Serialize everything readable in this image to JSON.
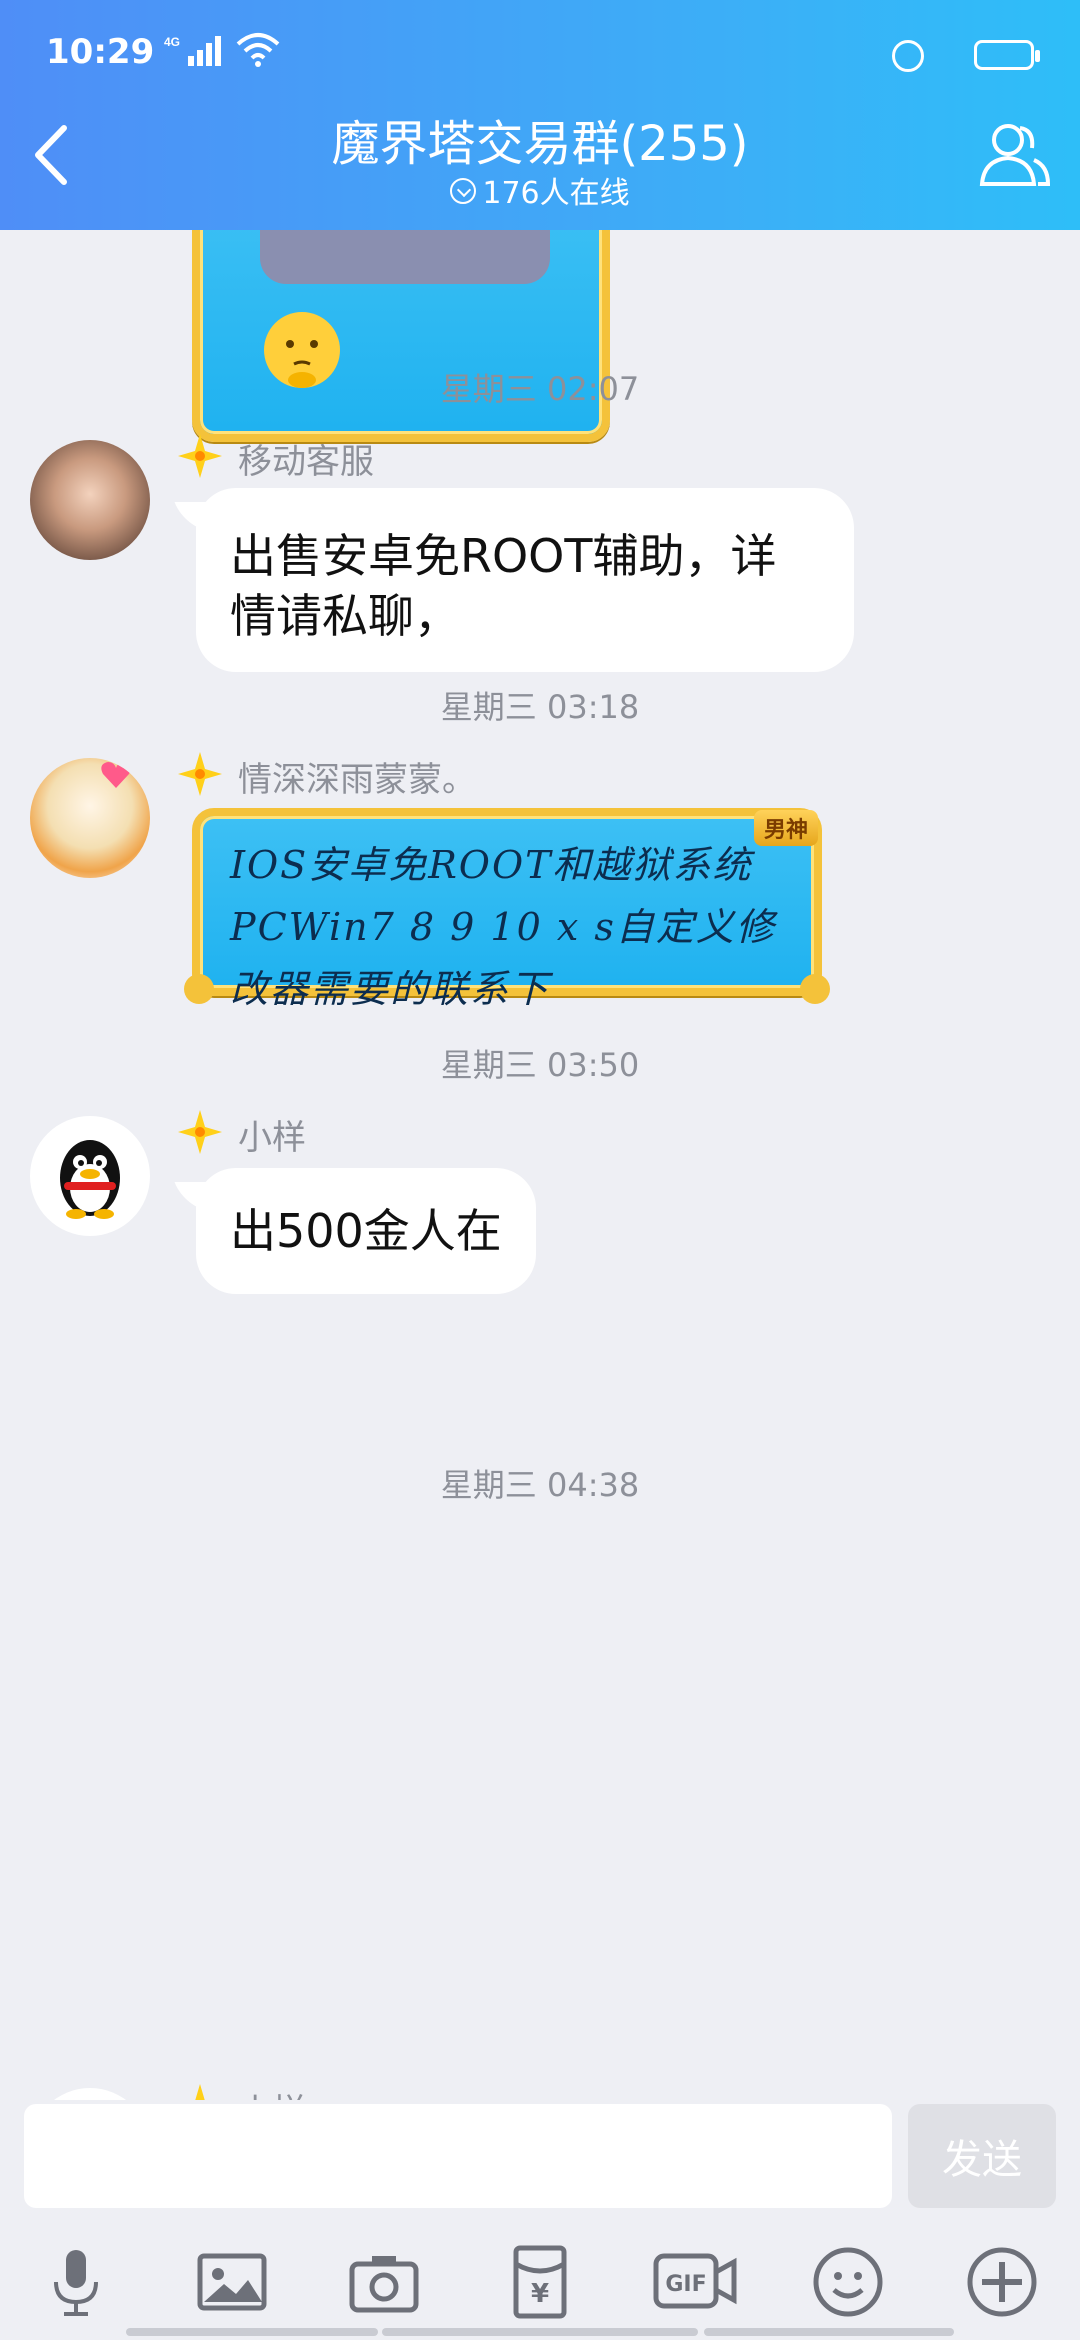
{
  "status_bar": {
    "time": "10:29",
    "network": "4G"
  },
  "header": {
    "title": "魔界塔交易群(255)",
    "subtitle": "176人在线"
  },
  "messages": [
    {
      "time": "星期三 02:07",
      "sender": "移动客服",
      "text": "出售安卓免ROOT辅助，详情请私聊，",
      "style": "plain"
    },
    {
      "time": "星期三 03:18",
      "sender": "情深深雨蒙蒙。",
      "text": "IOS安卓免ROOT和越狱系统PCWin7 8 9 10 x s自定义修改器需要的联系下",
      "style": "fancy",
      "tag": "男神"
    },
    {
      "time": "星期三 03:50",
      "sender": "小样",
      "text": "出500金人在",
      "style": "plain"
    },
    {
      "time": "星期三 04:38",
      "sender": "小样",
      "text": "",
      "style": "plain"
    }
  ],
  "input": {
    "placeholder": "",
    "send_label": "发送"
  },
  "toolbar": [
    "mic-icon",
    "image-icon",
    "camera-icon",
    "red-packet-icon",
    "gif-icon",
    "emoji-icon",
    "plus-icon"
  ],
  "colors": {
    "header_start": "#4f8ef7",
    "header_end": "#2ebef8",
    "background": "#eeeff4"
  }
}
